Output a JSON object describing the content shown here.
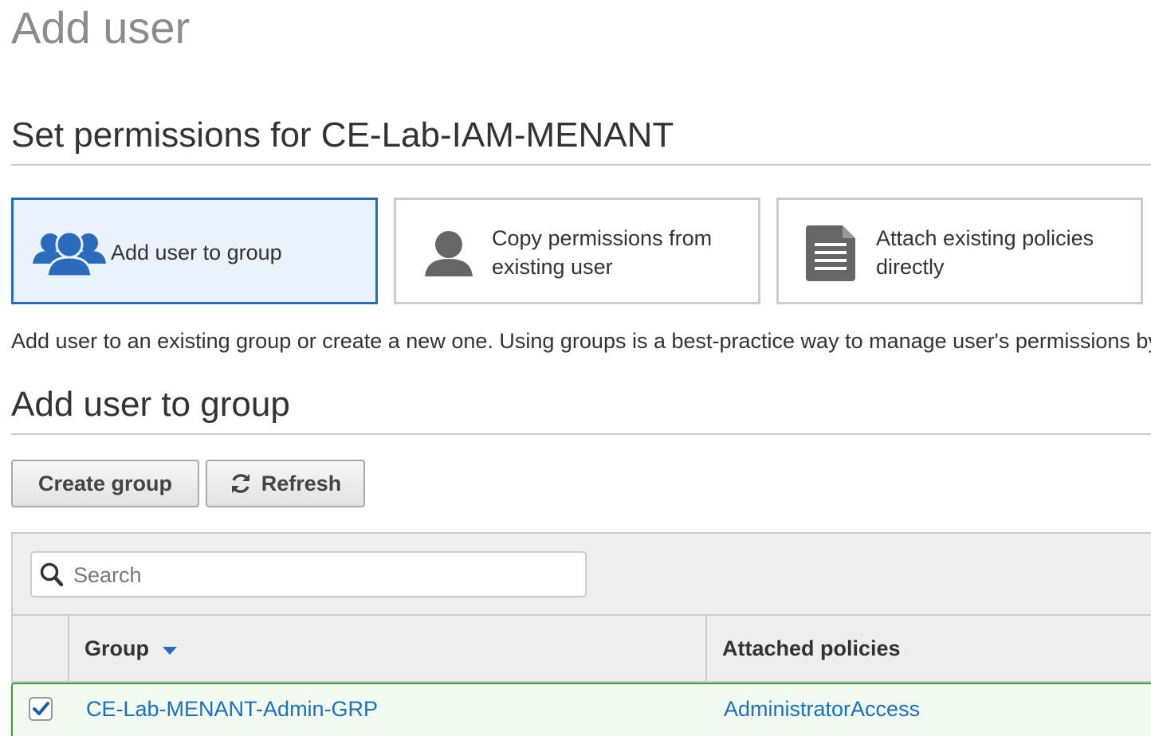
{
  "page": {
    "title": "Add user"
  },
  "permissions": {
    "heading": "Set permissions for CE-Lab-IAM-MENANT",
    "options": [
      {
        "label_line1": "Add user to group",
        "label_line2": "",
        "icon": "users-group-icon",
        "selected": true
      },
      {
        "label_line1": "Copy permissions from",
        "label_line2": "existing user",
        "icon": "user-icon",
        "selected": false
      },
      {
        "label_line1": "Attach existing policies",
        "label_line2": "directly",
        "icon": "document-icon",
        "selected": false
      }
    ],
    "description": "Add user to an existing group or create a new one. Using groups is a best-practice way to manage user's permissions by job functions."
  },
  "group_section": {
    "heading": "Add user to group",
    "create_group_label": "Create group",
    "refresh_label": "Refresh"
  },
  "search": {
    "placeholder": "Search",
    "value": ""
  },
  "table": {
    "columns": [
      "Group",
      "Attached policies"
    ],
    "sort_column": "Group",
    "rows": [
      {
        "checked": true,
        "group": "CE-Lab-MENANT-Admin-GRP",
        "policies": "AdministratorAccess"
      }
    ]
  },
  "colors": {
    "accent": "#2a6bbd",
    "link": "#1a6fc1",
    "selected_row_border": "#3ba03b",
    "icon_blue": "#2a6bbd",
    "icon_gray": "#666666"
  }
}
